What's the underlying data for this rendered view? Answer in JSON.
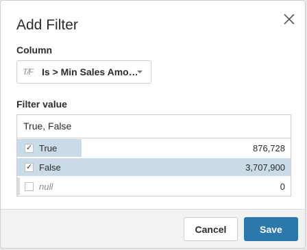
{
  "dialog": {
    "title": "Add Filter",
    "close_icon": "close-icon"
  },
  "column": {
    "label": "Column",
    "type_icon": "T/F",
    "selected": "Is > Min Sales Amo…"
  },
  "filter_value": {
    "label": "Filter value",
    "input_value": "True, False"
  },
  "list": {
    "rows": [
      {
        "label": "True",
        "count": "876,728",
        "checked": true,
        "fill": 0.235
      },
      {
        "label": "False",
        "count": "3,707,900",
        "checked": true,
        "fill": 1.0
      },
      {
        "label": "null",
        "count": "0",
        "checked": false,
        "fill": 0.0
      }
    ]
  },
  "footer": {
    "cancel_label": "Cancel",
    "save_label": "Save"
  },
  "colors": {
    "accent": "#2c78ad",
    "bar_fill": "#c8dbe6"
  }
}
